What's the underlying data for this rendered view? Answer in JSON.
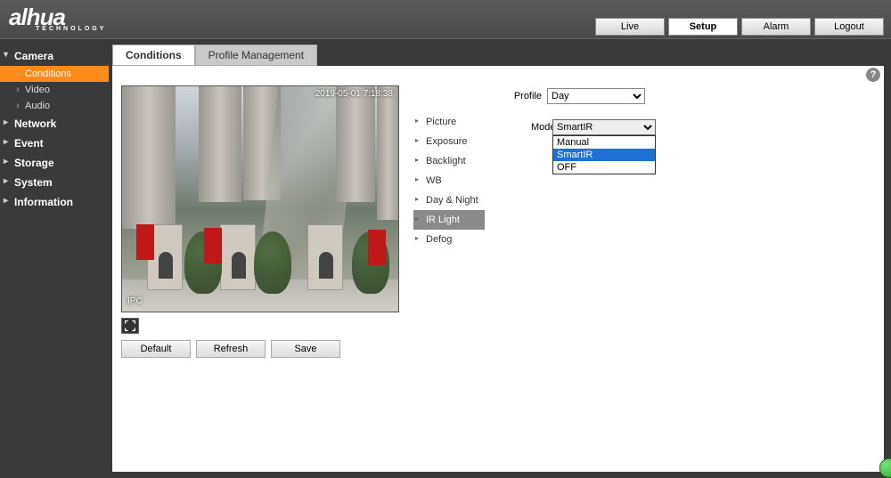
{
  "logo": {
    "brand": "alhua",
    "sub": "TECHNOLOGY"
  },
  "topnav": {
    "live": "Live",
    "setup": "Setup",
    "alarm": "Alarm",
    "logout": "Logout",
    "active": "Setup"
  },
  "sidebar": {
    "groups": [
      {
        "label": "Camera",
        "expanded": true,
        "items": [
          {
            "label": "Conditions",
            "active": true
          },
          {
            "label": "Video"
          },
          {
            "label": "Audio"
          }
        ]
      },
      {
        "label": "Network"
      },
      {
        "label": "Event"
      },
      {
        "label": "Storage"
      },
      {
        "label": "System"
      },
      {
        "label": "Information"
      }
    ]
  },
  "tabs": {
    "conditions": "Conditions",
    "profile_mgmt": "Profile Management",
    "active": "Conditions"
  },
  "preview": {
    "timestamp": "2019-05-01 7:18:38",
    "label": "IPC"
  },
  "buttons": {
    "default": "Default",
    "refresh": "Refresh",
    "save": "Save"
  },
  "settings_nav": {
    "items": [
      {
        "label": "Picture"
      },
      {
        "label": "Exposure"
      },
      {
        "label": "Backlight"
      },
      {
        "label": "WB"
      },
      {
        "label": "Day & Night"
      },
      {
        "label": "IR Light",
        "selected": true
      },
      {
        "label": "Defog"
      }
    ]
  },
  "profile": {
    "label": "Profile",
    "value": "Day"
  },
  "mode": {
    "label": "Mode",
    "value": "SmartIR",
    "options": [
      "Manual",
      "SmartIR",
      "OFF"
    ],
    "highlighted": "SmartIR"
  },
  "help_tooltip": "?"
}
